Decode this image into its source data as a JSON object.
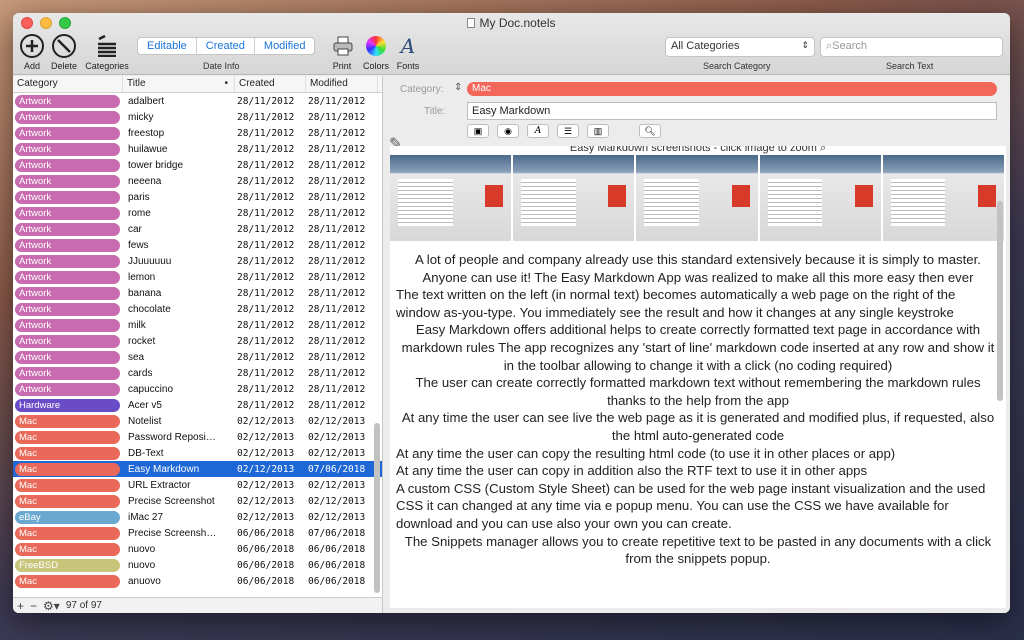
{
  "window": {
    "title": "My Doc.notels"
  },
  "toolbar": {
    "add": "Add",
    "delete": "Delete",
    "categories": "Categories",
    "seg": [
      "Editable",
      "Created",
      "Modified"
    ],
    "date_info": "Date Info",
    "print": "Print",
    "colors": "Colors",
    "fonts": "Fonts",
    "category_select": "All Categories",
    "search_placeholder": "Search",
    "search_category": "Search Category",
    "search_text": "Search Text"
  },
  "table": {
    "headers": {
      "category": "Category",
      "title": "Title",
      "created": "Created",
      "modified": "Modified"
    },
    "rows": [
      {
        "cat": "Artwork",
        "color": "#c86bb0",
        "title": "adalbert",
        "created": "28/11/2012",
        "modified": "28/11/2012"
      },
      {
        "cat": "Artwork",
        "color": "#c86bb0",
        "title": "micky",
        "created": "28/11/2012",
        "modified": "28/11/2012"
      },
      {
        "cat": "Artwork",
        "color": "#c86bb0",
        "title": "freestop",
        "created": "28/11/2012",
        "modified": "28/11/2012"
      },
      {
        "cat": "Artwork",
        "color": "#c86bb0",
        "title": "huilawue",
        "created": "28/11/2012",
        "modified": "28/11/2012"
      },
      {
        "cat": "Artwork",
        "color": "#c86bb0",
        "title": "tower bridge",
        "created": "28/11/2012",
        "modified": "28/11/2012"
      },
      {
        "cat": "Artwork",
        "color": "#c86bb0",
        "title": "neeena",
        "created": "28/11/2012",
        "modified": "28/11/2012"
      },
      {
        "cat": "Artwork",
        "color": "#c86bb0",
        "title": "paris",
        "created": "28/11/2012",
        "modified": "28/11/2012"
      },
      {
        "cat": "Artwork",
        "color": "#c86bb0",
        "title": "rome",
        "created": "28/11/2012",
        "modified": "28/11/2012"
      },
      {
        "cat": "Artwork",
        "color": "#c86bb0",
        "title": "car",
        "created": "28/11/2012",
        "modified": "28/11/2012"
      },
      {
        "cat": "Artwork",
        "color": "#c86bb0",
        "title": "fews",
        "created": "28/11/2012",
        "modified": "28/11/2012"
      },
      {
        "cat": "Artwork",
        "color": "#c86bb0",
        "title": "JJuuuuuu",
        "created": "28/11/2012",
        "modified": "28/11/2012"
      },
      {
        "cat": "Artwork",
        "color": "#c86bb0",
        "title": "lemon",
        "created": "28/11/2012",
        "modified": "28/11/2012"
      },
      {
        "cat": "Artwork",
        "color": "#c86bb0",
        "title": "banana",
        "created": "28/11/2012",
        "modified": "28/11/2012"
      },
      {
        "cat": "Artwork",
        "color": "#c86bb0",
        "title": "chocolate",
        "created": "28/11/2012",
        "modified": "28/11/2012"
      },
      {
        "cat": "Artwork",
        "color": "#c86bb0",
        "title": "milk",
        "created": "28/11/2012",
        "modified": "28/11/2012"
      },
      {
        "cat": "Artwork",
        "color": "#c86bb0",
        "title": "rocket",
        "created": "28/11/2012",
        "modified": "28/11/2012"
      },
      {
        "cat": "Artwork",
        "color": "#c86bb0",
        "title": "sea",
        "created": "28/11/2012",
        "modified": "28/11/2012"
      },
      {
        "cat": "Artwork",
        "color": "#c86bb0",
        "title": "cards",
        "created": "28/11/2012",
        "modified": "28/11/2012"
      },
      {
        "cat": "Artwork",
        "color": "#c86bb0",
        "title": "capuccino",
        "created": "28/11/2012",
        "modified": "28/11/2012"
      },
      {
        "cat": "Hardware",
        "color": "#6a4bc8",
        "title": "Acer v5",
        "created": "28/11/2012",
        "modified": "28/11/2012"
      },
      {
        "cat": "Mac",
        "color": "#e8685a",
        "title": "Notelist",
        "created": "02/12/2013",
        "modified": "02/12/2013"
      },
      {
        "cat": "Mac",
        "color": "#e8685a",
        "title": "Password Reposi…",
        "created": "02/12/2013",
        "modified": "02/12/2013"
      },
      {
        "cat": "Mac",
        "color": "#e8685a",
        "title": "DB-Text",
        "created": "02/12/2013",
        "modified": "02/12/2013"
      },
      {
        "cat": "Mac",
        "color": "#e8685a",
        "title": "Easy Markdown",
        "created": "02/12/2013",
        "modified": "07/06/2018",
        "selected": true
      },
      {
        "cat": "Mac",
        "color": "#e8685a",
        "title": "URL Extractor",
        "created": "02/12/2013",
        "modified": "02/12/2013"
      },
      {
        "cat": "Mac",
        "color": "#e8685a",
        "title": "Precise Screenshot",
        "created": "02/12/2013",
        "modified": "02/12/2013"
      },
      {
        "cat": "eBay",
        "color": "#6aa8d0",
        "title": "iMac 27",
        "created": "02/12/2013",
        "modified": "02/12/2013"
      },
      {
        "cat": "Mac",
        "color": "#e8685a",
        "title": "Precise Screensh…",
        "created": "06/06/2018",
        "modified": "07/06/2018"
      },
      {
        "cat": "Mac",
        "color": "#e8685a",
        "title": "nuovo",
        "created": "06/06/2018",
        "modified": "06/06/2018"
      },
      {
        "cat": "FreeBSD",
        "color": "#c8c47a",
        "title": "nuovo",
        "created": "06/06/2018",
        "modified": "06/06/2018"
      },
      {
        "cat": "Mac",
        "color": "#e8685a",
        "title": "anuovo",
        "created": "06/06/2018",
        "modified": "06/06/2018"
      }
    ],
    "count": "97 of 97"
  },
  "detail": {
    "category_label": "Category:",
    "category_value": "Mac",
    "category_color": "#f3665a",
    "title_label": "Title:",
    "title_value": "Easy Markdown",
    "screens_caption": "Easy Markdown screenshots - click image to zoom",
    "paragraphs": [
      {
        "t": "A lot of people and company already use this standard extensively because it is simply to master. Anyone can use it! The Easy Markdown App was realized to make all this more easy then ever",
        "align": "c"
      },
      {
        "t": "The text written on the left (in normal text) becomes automatically a web page on the right of the window as-you-type. You immediately see the result and how it changes at any single keystroke",
        "align": "l"
      },
      {
        "t": "Easy Markdown offers additional helps to create correctly formatted text page in accordance with markdown rules The app recognizes any 'start of line' markdown code inserted at any row and show it in the toolbar allowing to change it with a click (no coding required)",
        "align": "c"
      },
      {
        "t": "The user can create correctly formatted markdown text without remembering the markdown rules thanks to the help from the app",
        "align": "c"
      },
      {
        "t": "At any time the user can see live the web page as it is generated and modified plus, if requested, also the html auto-generated code",
        "align": "c"
      },
      {
        "t": "At any time the user can copy the resulting html code (to use it in other places or app)",
        "align": "l"
      },
      {
        "t": "At any time the user can copy in addition also the RTF text to use it in other apps",
        "align": "l"
      },
      {
        "t": "A custom CSS (Custom Style Sheet) can be used for the web page instant visualization and the used CSS it can changed at any time via e popup menu. You can use the CSS we have available for download and you can use also your own you can create.",
        "align": "l"
      },
      {
        "t": "The Snippets manager allows you to create repetitive text to be pasted in any documents with a click from the snippets popup.",
        "align": "c"
      }
    ]
  }
}
